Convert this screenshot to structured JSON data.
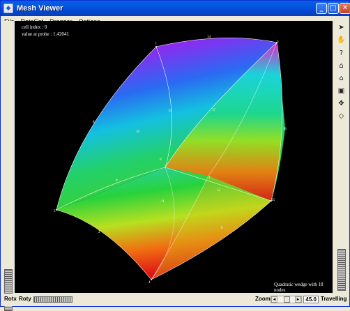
{
  "window": {
    "title": "Mesh Viewer"
  },
  "title_buttons": {
    "minimize": "_",
    "maximize": "□",
    "close": "✕"
  },
  "menu": {
    "items": [
      "File",
      "DataSet",
      "Dragger",
      "Options"
    ]
  },
  "viewport": {
    "cell_index": "cell index : 0",
    "probe_value": "value at probe : 1.42041",
    "caption": "Quadratic wedge with 18 nodes",
    "node_labels": [
      "14",
      "8",
      "13",
      "10",
      "17",
      "0",
      "16",
      "9",
      "1",
      "12",
      "11",
      "2",
      "15",
      "6",
      "5",
      "3",
      "7",
      "4"
    ],
    "mesh_colors": {
      "top": "#d020d8",
      "mid": "#14c8e0",
      "green": "#28d23c",
      "bottom": "#e01414"
    }
  },
  "toolbar": {
    "icons": [
      "pointer-icon",
      "hand-icon",
      "help-icon",
      "home-icon",
      "set-home-icon",
      "view-all-icon",
      "seek-icon",
      "perspective-icon"
    ]
  },
  "bottom": {
    "rotx_label": "Rotx",
    "roty_label": "Roty",
    "zoom_label": "Zoom",
    "zoom_value": "45.0",
    "dolly_label": "Travelling",
    "zoom_left_arrow": "◄",
    "zoom_right_arrow": "►"
  }
}
